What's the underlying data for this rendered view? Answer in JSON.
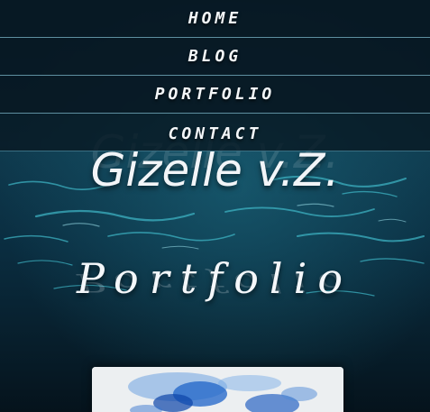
{
  "nav": {
    "items": [
      {
        "label": "HOME"
      },
      {
        "label": "BLOG"
      },
      {
        "label": "PORTFOLIO"
      },
      {
        "label": "CONTACT"
      }
    ]
  },
  "site": {
    "title": "Gizelle v.Z."
  },
  "page": {
    "heading": "Portfolio"
  },
  "colors": {
    "nav_background": "#081822",
    "nav_divider": "#5e8fa0",
    "text": "#f4f7fa",
    "water_dark": "#061a27",
    "water_highlight": "#3fb8c8",
    "thumbnail_ink": "#1e63c8"
  }
}
